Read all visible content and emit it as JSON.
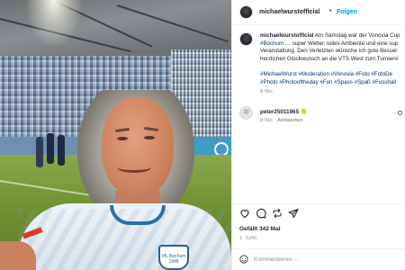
{
  "post": {
    "username": "michaelwurstofficial",
    "separator": "•",
    "follow_label": "Folgen"
  },
  "caption": {
    "username": "michaelwurstofficial",
    "line1": " Am Samstag war der Vonovia Cup",
    "line2_tag": "#Bochum",
    "line2_text": " … super Wetter, tolles Ambiente und eine sup",
    "line3": "Veranstaltung. Den Verletzten wünsche ich gute Besser",
    "line4": "herzlichen Glückwunsch an die VTS West zum Turniersi",
    "hashtags_line1": "#MichaelWurst #Moderation #Vonovia #Foto #FotoDe",
    "hashtags_line2": "#Photo #Photooftheday #Fun #Spass #Spaß #Fussball",
    "time_ago": "8 Wo."
  },
  "comment": {
    "username": "peter25011965",
    "emoji": "👏",
    "time_ago": "8 Wo.",
    "reply_label": "Antworten"
  },
  "stats": {
    "likes": "Gefällt 342 Mal",
    "date": "1. JUNI"
  },
  "comment_box": {
    "placeholder": "Kommentieren ..."
  },
  "photo": {
    "crest_text": "VfL Bochum 1848"
  },
  "colors": {
    "link_blue": "#0095f6",
    "hashtag_blue": "#00376b",
    "muted": "#8e8e8e"
  },
  "icons": [
    "like-icon",
    "comment-icon",
    "share-icon",
    "save-icon",
    "emoji-icon",
    "heart-icon",
    "avatar"
  ]
}
